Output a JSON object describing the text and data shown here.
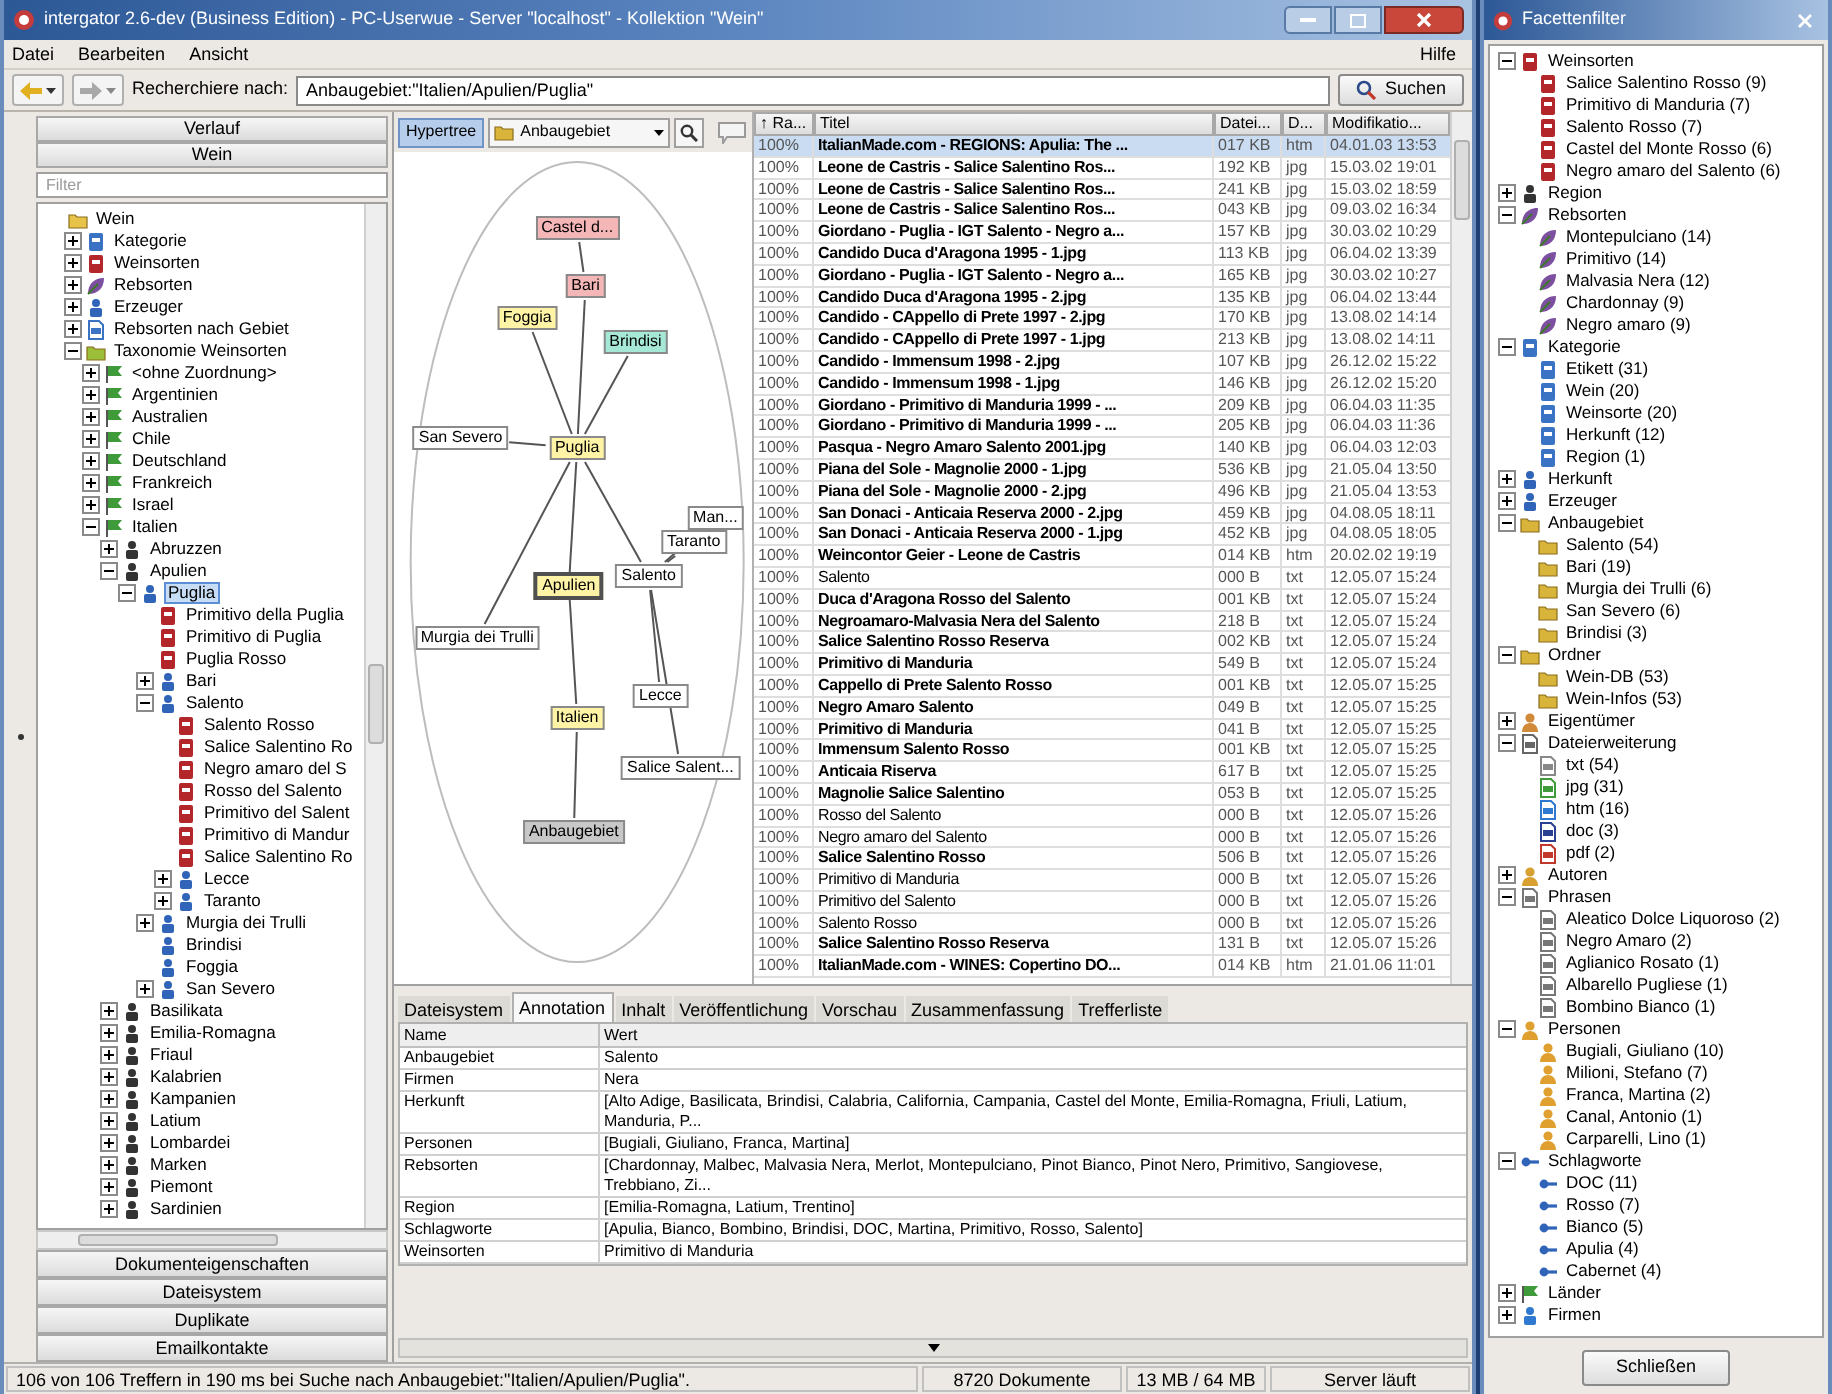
{
  "window": {
    "title": "intergator 2.6-dev (Business Edition) - PC-Userwue - Server \"localhost\" - Kollektion \"Wein\""
  },
  "menu": [
    "Datei",
    "Bearbeiten",
    "Ansicht"
  ],
  "help_menu": "Hilfe",
  "toolbar": {
    "search_label": "Recherchiere nach:",
    "search_value": "Anbaugebiet:\"Italien/Apulien/Puglia\"",
    "search_button": "Suchen"
  },
  "left_panel": {
    "sections": [
      "Verlauf",
      "Wein"
    ],
    "filter_placeholder": "Filter",
    "tree": [
      {
        "label": "Wein",
        "kind": "folder",
        "selected": false,
        "children": [
          {
            "label": "Kategorie",
            "kind": "category",
            "selected": false,
            "expanded": false
          },
          {
            "label": "Weinsorten",
            "kind": "wine",
            "selected": false,
            "expanded": false
          },
          {
            "label": "Rebsorten",
            "kind": "grape",
            "selected": false,
            "expanded": false
          },
          {
            "label": "Erzeuger",
            "kind": "producer",
            "selected": false,
            "expanded": false
          },
          {
            "label": "Rebsorten nach Gebiet",
            "kind": "map",
            "selected": false,
            "expanded": false
          },
          {
            "label": "Taxonomie Weinsorten",
            "kind": "taxonomy",
            "selected": false,
            "expanded": true,
            "children": [
              {
                "label": "<ohne Zuordnung>",
                "kind": "country",
                "selected": false,
                "expanded": false
              },
              {
                "label": "Argentinien",
                "kind": "country",
                "selected": false,
                "expanded": false
              },
              {
                "label": "Australien",
                "kind": "country",
                "selected": false,
                "expanded": false
              },
              {
                "label": "Chile",
                "kind": "country",
                "selected": false,
                "expanded": false
              },
              {
                "label": "Deutschland",
                "kind": "country",
                "selected": false,
                "expanded": false
              },
              {
                "label": "Frankreich",
                "kind": "country",
                "selected": false,
                "expanded": false
              },
              {
                "label": "Israel",
                "kind": "country",
                "selected": false,
                "expanded": false
              },
              {
                "label": "Italien",
                "kind": "country",
                "selected": false,
                "expanded": true,
                "children": [
                  {
                    "label": "Abruzzen",
                    "kind": "region",
                    "selected": false,
                    "expanded": false
                  },
                  {
                    "label": "Apulien",
                    "kind": "region",
                    "selected": false,
                    "expanded": true,
                    "children": [
                      {
                        "label": "Puglia",
                        "kind": "area",
                        "selected": true,
                        "expanded": true,
                        "children": [
                          {
                            "label": "Primitivo della Puglia",
                            "kind": "wine",
                            "selected": false
                          },
                          {
                            "label": "Primitivo di Puglia",
                            "kind": "wine",
                            "selected": false
                          },
                          {
                            "label": "Puglia Rosso",
                            "kind": "wine",
                            "selected": false
                          },
                          {
                            "label": "Bari",
                            "kind": "area",
                            "selected": false,
                            "expanded": false
                          },
                          {
                            "label": "Salento",
                            "kind": "area",
                            "selected": false,
                            "expanded": true,
                            "children": [
                              {
                                "label": "Salento Rosso",
                                "kind": "wine",
                                "selected": false
                              },
                              {
                                "label": "Salice Salentino Ro",
                                "kind": "wine",
                                "selected": false
                              },
                              {
                                "label": "Negro amaro del S",
                                "kind": "wine",
                                "selected": false
                              },
                              {
                                "label": "Rosso del Salento",
                                "kind": "wine",
                                "selected": false
                              },
                              {
                                "label": "Primitivo del Salent",
                                "kind": "wine",
                                "selected": false
                              },
                              {
                                "label": "Primitivo di Mandur",
                                "kind": "wine",
                                "selected": false
                              },
                              {
                                "label": "Salice Salentino Ro",
                                "kind": "wine",
                                "selected": false
                              },
                              {
                                "label": "Lecce",
                                "kind": "area",
                                "selected": false,
                                "expanded": false
                              },
                              {
                                "label": "Taranto",
                                "kind": "area",
                                "selected": false,
                                "expanded": false
                              }
                            ]
                          },
                          {
                            "label": "Murgia dei Trulli",
                            "kind": "area",
                            "selected": false,
                            "expanded": false
                          },
                          {
                            "label": "Brindisi",
                            "kind": "area",
                            "selected": false
                          },
                          {
                            "label": "Foggia",
                            "kind": "area",
                            "selected": false
                          },
                          {
                            "label": "San Severo",
                            "kind": "area",
                            "selected": false,
                            "expanded": false
                          }
                        ]
                      }
                    ]
                  },
                  {
                    "label": "Basilikata",
                    "kind": "region",
                    "selected": false,
                    "expanded": false
                  },
                  {
                    "label": "Emilia-Romagna",
                    "kind": "region",
                    "selected": false,
                    "expanded": false
                  },
                  {
                    "label": "Friaul",
                    "kind": "region",
                    "selected": false,
                    "expanded": false
                  },
                  {
                    "label": "Kalabrien",
                    "kind": "region",
                    "selected": false,
                    "expanded": false
                  },
                  {
                    "label": "Kampanien",
                    "kind": "region",
                    "selected": false,
                    "expanded": false
                  },
                  {
                    "label": "Latium",
                    "kind": "region",
                    "selected": false,
                    "expanded": false
                  },
                  {
                    "label": "Lombardei",
                    "kind": "region",
                    "selected": false,
                    "expanded": false
                  },
                  {
                    "label": "Marken",
                    "kind": "region",
                    "selected": false,
                    "expanded": false
                  },
                  {
                    "label": "Piemont",
                    "kind": "region",
                    "selected": false,
                    "expanded": false
                  },
                  {
                    "label": "Sardinien",
                    "kind": "region",
                    "selected": false,
                    "expanded": false
                  }
                ]
              }
            ]
          }
        ]
      }
    ],
    "buttons": [
      "Dokumenteigenschaften",
      "Dateisystem",
      "Duplikate",
      "Emailkontakte"
    ]
  },
  "hypertree": {
    "mode_button": {
      "label": "Hypertree",
      "selected": true
    },
    "facet": "Anbaugebiet",
    "nodes": [
      {
        "label": "Castel d...",
        "color": "#f4b6b6",
        "selected": false
      },
      {
        "label": "Bari",
        "color": "#f4b6b6",
        "selected": false
      },
      {
        "label": "Foggia",
        "color": "#fff3a6",
        "selected": false
      },
      {
        "label": "Brindisi",
        "color": "#a6e8d6",
        "selected": false
      },
      {
        "label": "San Severo",
        "color": "#ffffff",
        "selected": false
      },
      {
        "label": "Puglia",
        "color": "#fff3a6",
        "selected": false
      },
      {
        "label": "Man...",
        "color": "#ffffff",
        "selected": false
      },
      {
        "label": "Taranto",
        "color": "#ffffff",
        "selected": false
      },
      {
        "label": "Salento",
        "color": "#ffffff",
        "selected": false
      },
      {
        "label": "Apulien",
        "color": "#fff3a6",
        "selected": true
      },
      {
        "label": "Murgia dei Trulli",
        "color": "#ffffff",
        "selected": false
      },
      {
        "label": "Lecce",
        "color": "#ffffff",
        "selected": false
      },
      {
        "label": "Italien",
        "color": "#fff3a6",
        "selected": false
      },
      {
        "label": "Salice Salent...",
        "color": "#ffffff",
        "selected": false
      },
      {
        "label": "Anbaugebiet",
        "color": "#c8c8c8",
        "selected": false
      }
    ]
  },
  "results": {
    "columns": [
      "↑ Ra...",
      "Titel",
      "Datei...",
      "D...",
      "Modifikatio..."
    ],
    "rows": [
      {
        "rank": "100%",
        "title": "ItalianMade.com - REGIONS: Apulia: The ...",
        "size": "017 KB",
        "type": "htm",
        "modified": "04.01.03 13:53",
        "bold": true,
        "selected": true
      },
      {
        "rank": "100%",
        "title": "Leone de Castris - Salice Salentino Ros...",
        "size": "192 KB",
        "type": "jpg",
        "modified": "15.03.02 19:01",
        "bold": true,
        "selected": false
      },
      {
        "rank": "100%",
        "title": "Leone de Castris - Salice Salentino Ros...",
        "size": "241 KB",
        "type": "jpg",
        "modified": "15.03.02 18:59",
        "bold": true,
        "selected": false
      },
      {
        "rank": "100%",
        "title": "Leone de Castris - Salice Salentino Ros...",
        "size": "043 KB",
        "type": "jpg",
        "modified": "09.03.02 16:34",
        "bold": true,
        "selected": false
      },
      {
        "rank": "100%",
        "title": "Giordano - Puglia - IGT Salento - Negro a...",
        "size": "157 KB",
        "type": "jpg",
        "modified": "30.03.02 10:29",
        "bold": true,
        "selected": false
      },
      {
        "rank": "100%",
        "title": "Candido Duca d'Aragona 1995 - 1.jpg",
        "size": "113 KB",
        "type": "jpg",
        "modified": "06.04.02 13:39",
        "bold": true,
        "selected": false
      },
      {
        "rank": "100%",
        "title": "Giordano - Puglia - IGT Salento - Negro a...",
        "size": "165 KB",
        "type": "jpg",
        "modified": "30.03.02 10:27",
        "bold": true,
        "selected": false
      },
      {
        "rank": "100%",
        "title": "Candido Duca d'Aragona 1995 - 2.jpg",
        "size": "135 KB",
        "type": "jpg",
        "modified": "06.04.02 13:44",
        "bold": true,
        "selected": false
      },
      {
        "rank": "100%",
        "title": "Candido - CAppello di Prete 1997 - 2.jpg",
        "size": "170 KB",
        "type": "jpg",
        "modified": "13.08.02 14:14",
        "bold": true,
        "selected": false
      },
      {
        "rank": "100%",
        "title": "Candido - CAppello di Prete 1997 - 1.jpg",
        "size": "213 KB",
        "type": "jpg",
        "modified": "13.08.02 14:11",
        "bold": true,
        "selected": false
      },
      {
        "rank": "100%",
        "title": "Candido - Immensum 1998 - 2.jpg",
        "size": "107 KB",
        "type": "jpg",
        "modified": "26.12.02 15:22",
        "bold": true,
        "selected": false
      },
      {
        "rank": "100%",
        "title": "Candido - Immensum 1998 - 1.jpg",
        "size": "146 KB",
        "type": "jpg",
        "modified": "26.12.02 15:20",
        "bold": true,
        "selected": false
      },
      {
        "rank": "100%",
        "title": "Giordano - Primitivo di Manduria 1999 - ...",
        "size": "209 KB",
        "type": "jpg",
        "modified": "06.04.03 11:35",
        "bold": true,
        "selected": false
      },
      {
        "rank": "100%",
        "title": "Giordano - Primitivo di Manduria 1999 - ...",
        "size": "205 KB",
        "type": "jpg",
        "modified": "06.04.03 11:36",
        "bold": true,
        "selected": false
      },
      {
        "rank": "100%",
        "title": "Pasqua - Negro Amaro Salento 2001.jpg",
        "size": "140 KB",
        "type": "jpg",
        "modified": "06.04.03 12:03",
        "bold": true,
        "selected": false
      },
      {
        "rank": "100%",
        "title": "Piana del Sole - Magnolie 2000 - 1.jpg",
        "size": "536 KB",
        "type": "jpg",
        "modified": "21.05.04 13:50",
        "bold": true,
        "selected": false
      },
      {
        "rank": "100%",
        "title": "Piana del Sole - Magnolie 2000 - 2.jpg",
        "size": "496 KB",
        "type": "jpg",
        "modified": "21.05.04 13:53",
        "bold": true,
        "selected": false
      },
      {
        "rank": "100%",
        "title": "San Donaci - Anticaia Reserva 2000 - 2.jpg",
        "size": "459 KB",
        "type": "jpg",
        "modified": "04.08.05 18:11",
        "bold": true,
        "selected": false
      },
      {
        "rank": "100%",
        "title": "San Donaci - Anticaia Reserva 2000 - 1.jpg",
        "size": "452 KB",
        "type": "jpg",
        "modified": "04.08.05 18:05",
        "bold": true,
        "selected": false
      },
      {
        "rank": "100%",
        "title": "Weincontor Geier - Leone de Castris",
        "size": "014 KB",
        "type": "htm",
        "modified": "20.02.02 19:19",
        "bold": true,
        "selected": false
      },
      {
        "rank": "100%",
        "title": "Salento",
        "size": "000 B",
        "type": "txt",
        "modified": "12.05.07 15:24",
        "bold": false,
        "selected": false
      },
      {
        "rank": "100%",
        "title": "Duca d'Aragona Rosso del Salento",
        "size": "001 KB",
        "type": "txt",
        "modified": "12.05.07 15:24",
        "bold": true,
        "selected": false
      },
      {
        "rank": "100%",
        "title": "Negroamaro-Malvasia Nera del Salento",
        "size": "218 B",
        "type": "txt",
        "modified": "12.05.07 15:24",
        "bold": true,
        "selected": false
      },
      {
        "rank": "100%",
        "title": "Salice Salentino Rosso Reserva",
        "size": "002 KB",
        "type": "txt",
        "modified": "12.05.07 15:24",
        "bold": true,
        "selected": false
      },
      {
        "rank": "100%",
        "title": "Primitivo di Manduria",
        "size": "549 B",
        "type": "txt",
        "modified": "12.05.07 15:24",
        "bold": true,
        "selected": false
      },
      {
        "rank": "100%",
        "title": "Cappello di Prete Salento Rosso",
        "size": "001 KB",
        "type": "txt",
        "modified": "12.05.07 15:25",
        "bold": true,
        "selected": false
      },
      {
        "rank": "100%",
        "title": "Negro Amaro Salento",
        "size": "049 B",
        "type": "txt",
        "modified": "12.05.07 15:25",
        "bold": true,
        "selected": false
      },
      {
        "rank": "100%",
        "title": "Primitivo di Manduria",
        "size": "041 B",
        "type": "txt",
        "modified": "12.05.07 15:25",
        "bold": true,
        "selected": false
      },
      {
        "rank": "100%",
        "title": "Immensum Salento Rosso",
        "size": "001 KB",
        "type": "txt",
        "modified": "12.05.07 15:25",
        "bold": true,
        "selected": false
      },
      {
        "rank": "100%",
        "title": "Anticaia Riserva",
        "size": "617 B",
        "type": "txt",
        "modified": "12.05.07 15:25",
        "bold": true,
        "selected": false
      },
      {
        "rank": "100%",
        "title": "Magnolie Salice Salentino",
        "size": "053 B",
        "type": "txt",
        "modified": "12.05.07 15:25",
        "bold": true,
        "selected": false
      },
      {
        "rank": "100%",
        "title": "Rosso del Salento",
        "size": "000 B",
        "type": "txt",
        "modified": "12.05.07 15:26",
        "bold": false,
        "selected": false
      },
      {
        "rank": "100%",
        "title": "Negro amaro del Salento",
        "size": "000 B",
        "type": "txt",
        "modified": "12.05.07 15:26",
        "bold": false,
        "selected": false
      },
      {
        "rank": "100%",
        "title": "Salice Salentino Rosso",
        "size": "506 B",
        "type": "txt",
        "modified": "12.05.07 15:26",
        "bold": true,
        "selected": false
      },
      {
        "rank": "100%",
        "title": "Primitivo di Manduria",
        "size": "000 B",
        "type": "txt",
        "modified": "12.05.07 15:26",
        "bold": false,
        "selected": false
      },
      {
        "rank": "100%",
        "title": "Primitivo del Salento",
        "size": "000 B",
        "type": "txt",
        "modified": "12.05.07 15:26",
        "bold": false,
        "selected": false
      },
      {
        "rank": "100%",
        "title": "Salento Rosso",
        "size": "000 B",
        "type": "txt",
        "modified": "12.05.07 15:26",
        "bold": false,
        "selected": false
      },
      {
        "rank": "100%",
        "title": "Salice Salentino Rosso Reserva",
        "size": "131 B",
        "type": "txt",
        "modified": "12.05.07 15:26",
        "bold": true,
        "selected": false
      },
      {
        "rank": "100%",
        "title": "ItalianMade.com - WINES: Copertino DO...",
        "size": "014 KB",
        "type": "htm",
        "modified": "21.01.06 11:01",
        "bold": true,
        "selected": false
      }
    ]
  },
  "detail": {
    "tabs": [
      {
        "label": "Dateisystem",
        "selected": false
      },
      {
        "label": "Annotation",
        "selected": true
      },
      {
        "label": "Inhalt",
        "selected": false
      },
      {
        "label": "Veröffentlichung",
        "selected": false
      },
      {
        "label": "Vorschau",
        "selected": false
      },
      {
        "label": "Zusammenfassung",
        "selected": false
      },
      {
        "label": "Trefferliste",
        "selected": false
      }
    ],
    "columns": [
      "Name",
      "Wert"
    ],
    "rows": [
      {
        "name": "Anbaugebiet",
        "value": "Salento"
      },
      {
        "name": "Firmen",
        "value": "Nera"
      },
      {
        "name": "Herkunft",
        "value": "[Alto Adige, Basilicata, Brindisi, Calabria, California, Campania, Castel del Monte, Emilia-Romagna, Friuli, Latium, Manduria, P..."
      },
      {
        "name": "Personen",
        "value": "[Bugiali, Giuliano, Franca, Martina]"
      },
      {
        "name": "Rebsorten",
        "value": "[Chardonnay, Malbec, Malvasia Nera, Merlot, Montepulciano, Pinot Bianco, Pinot Nero, Primitivo, Sangiovese, Trebbiano, Zi..."
      },
      {
        "name": "Region",
        "value": "[Emilia-Romagna, Latium, Trentino]"
      },
      {
        "name": "Schlagworte",
        "value": "[Apulia, Bianco, Bombino, Brindisi, DOC, Martina, Primitivo, Rosso, Salento]"
      },
      {
        "name": "Weinsorten",
        "value": "Primitivo di Manduria"
      }
    ]
  },
  "status_bar": {
    "message": "106 von 106 Treffern in 190 ms bei Suche nach Anbaugebiet:\"Italien/Apulien/Puglia\".",
    "documents": "8720 Dokumente",
    "memory": "13 MB / 64 MB",
    "server": "Server läuft"
  },
  "facet_filter": {
    "title": "Facettenfilter",
    "close_button": "Schließen",
    "tree": [
      {
        "label": "Weinsorten",
        "kind": "wine",
        "expanded": true,
        "children": [
          {
            "label": "Salice Salentino Rosso (9)",
            "kind": "wine"
          },
          {
            "label": "Primitivo di Manduria (7)",
            "kind": "wine"
          },
          {
            "label": "Salento Rosso (7)",
            "kind": "wine"
          },
          {
            "label": "Castel del Monte Rosso (6)",
            "kind": "wine"
          },
          {
            "label": "Negro amaro del Salento (6)",
            "kind": "wine"
          }
        ]
      },
      {
        "label": "Region",
        "kind": "region",
        "expanded": false
      },
      {
        "label": "Rebsorten",
        "kind": "grape",
        "expanded": true,
        "children": [
          {
            "label": "Montepulciano (14)",
            "kind": "grape"
          },
          {
            "label": "Primitivo (14)",
            "kind": "grape"
          },
          {
            "label": "Malvasia Nera (12)",
            "kind": "grape"
          },
          {
            "label": "Chardonnay (9)",
            "kind": "grape"
          },
          {
            "label": "Negro amaro (9)",
            "kind": "grape"
          }
        ]
      },
      {
        "label": "Kategorie",
        "kind": "category",
        "expanded": true,
        "children": [
          {
            "label": "Etikett (31)",
            "kind": "category"
          },
          {
            "label": "Wein (20)",
            "kind": "category"
          },
          {
            "label": "Weinsorte (20)",
            "kind": "category"
          },
          {
            "label": "Herkunft (12)",
            "kind": "category"
          },
          {
            "label": "Region (1)",
            "kind": "category"
          }
        ]
      },
      {
        "label": "Herkunft",
        "kind": "area",
        "expanded": false
      },
      {
        "label": "Erzeuger",
        "kind": "producer",
        "expanded": false
      },
      {
        "label": "Anbaugebiet",
        "kind": "anbau",
        "expanded": true,
        "children": [
          {
            "label": "Salento (54)",
            "kind": "anbau"
          },
          {
            "label": "Bari (19)",
            "kind": "anbau"
          },
          {
            "label": "Murgia dei Trulli (6)",
            "kind": "anbau"
          },
          {
            "label": "San Severo (6)",
            "kind": "anbau"
          },
          {
            "label": "Brindisi (3)",
            "kind": "anbau"
          }
        ]
      },
      {
        "label": "Ordner",
        "kind": "anbau",
        "expanded": true,
        "children": [
          {
            "label": "Wein-DB (53)",
            "kind": "anbau"
          },
          {
            "label": "Wein-Infos (53)",
            "kind": "anbau"
          }
        ]
      },
      {
        "label": "Eigentümer",
        "kind": "owner",
        "expanded": false
      },
      {
        "label": "Dateierweiterung",
        "kind": "file",
        "expanded": true,
        "children": [
          {
            "label": "txt (54)",
            "kind": "txt"
          },
          {
            "label": "jpg (31)",
            "kind": "jpg"
          },
          {
            "label": "htm (16)",
            "kind": "htm"
          },
          {
            "label": "doc (3)",
            "kind": "doc"
          },
          {
            "label": "pdf (2)",
            "kind": "pdf"
          }
        ]
      },
      {
        "label": "Autoren",
        "kind": "author",
        "expanded": false
      },
      {
        "label": "Phrasen",
        "kind": "phrase",
        "expanded": true,
        "children": [
          {
            "label": "Aleatico Dolce Liquoroso (2)",
            "kind": "phrase"
          },
          {
            "label": "Negro Amaro (2)",
            "kind": "phrase"
          },
          {
            "label": "Aglianico Rosato (1)",
            "kind": "phrase"
          },
          {
            "label": "Albarello Pugliese (1)",
            "kind": "phrase"
          },
          {
            "label": "Bombino Bianco (1)",
            "kind": "phrase"
          }
        ]
      },
      {
        "label": "Personen",
        "kind": "person",
        "expanded": true,
        "children": [
          {
            "label": "Bugiali, Giuliano (10)",
            "kind": "person"
          },
          {
            "label": "Milioni, Stefano (7)",
            "kind": "person"
          },
          {
            "label": "Franca, Martina (2)",
            "kind": "person"
          },
          {
            "label": "Canal, Antonio (1)",
            "kind": "person"
          },
          {
            "label": "Carparelli, Lino (1)",
            "kind": "person"
          }
        ]
      },
      {
        "label": "Schlagworte",
        "kind": "tag",
        "expanded": true,
        "children": [
          {
            "label": "DOC (11)",
            "kind": "tag"
          },
          {
            "label": "Rosso (7)",
            "kind": "tag"
          },
          {
            "label": "Bianco (5)",
            "kind": "tag"
          },
          {
            "label": "Apulia (4)",
            "kind": "tag"
          },
          {
            "label": "Cabernet (4)",
            "kind": "tag"
          }
        ]
      },
      {
        "label": "Länder",
        "kind": "country",
        "expanded": false
      },
      {
        "label": "Firmen",
        "kind": "company",
        "expanded": false
      }
    ]
  }
}
